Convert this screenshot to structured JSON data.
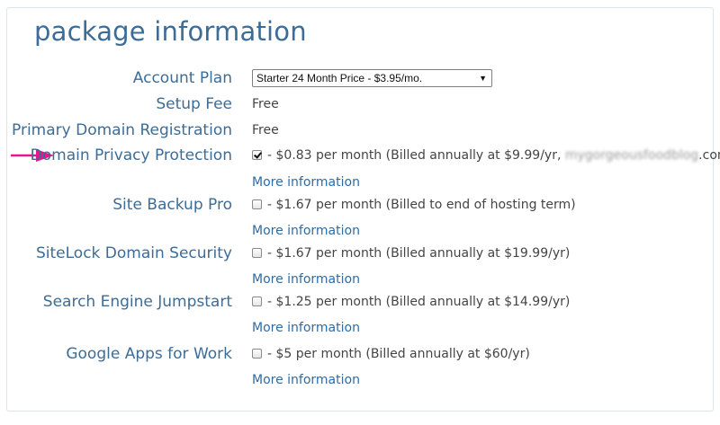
{
  "header": {
    "title": "package information"
  },
  "colors": {
    "accent": "#3d6c97",
    "link": "#2f6ba4",
    "pointer": "#e8168a"
  },
  "account_plan": {
    "label": "Account Plan",
    "selected": "Starter 24 Month Price - $3.95/mo."
  },
  "setup_fee": {
    "label": "Setup Fee",
    "value": "Free"
  },
  "primary_domain": {
    "label": "Primary Domain Registration",
    "value": "Free"
  },
  "addons": [
    {
      "label": "Domain Privacy Protection",
      "checked": true,
      "text": "- $0.83 per month (Billed annually at $9.99/yr,",
      "domain_blurred": "mygorgeousfoodblog",
      "domain_suffix": ".com)",
      "more": "More information"
    },
    {
      "label": "Site Backup Pro",
      "checked": false,
      "text": "- $1.67 per month (Billed to end of hosting term)",
      "more": "More information"
    },
    {
      "label": "SiteLock Domain Security",
      "checked": false,
      "text": "- $1.67 per month (Billed annually at $19.99/yr)",
      "more": "More information"
    },
    {
      "label": "Search Engine Jumpstart",
      "checked": false,
      "text": "- $1.25 per month (Billed annually at $14.99/yr)",
      "more": "More information"
    },
    {
      "label": "Google Apps for Work",
      "checked": false,
      "text": "- $5 per month (Billed annually at $60/yr)",
      "more": "More information"
    }
  ]
}
